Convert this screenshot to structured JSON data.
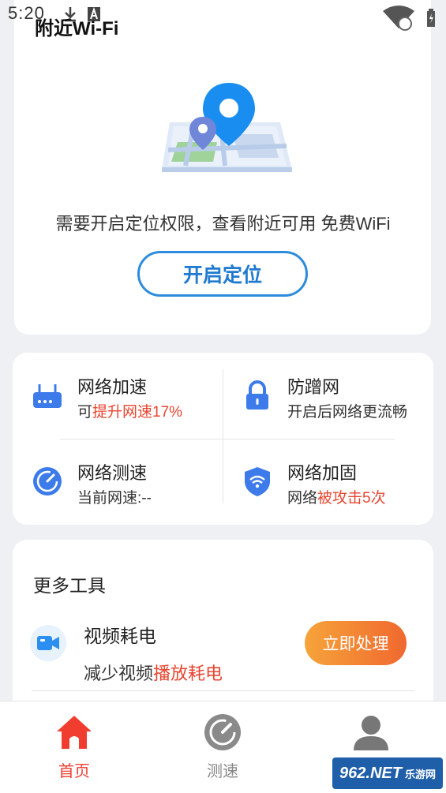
{
  "status_bar": {
    "time": "5:20",
    "icons": [
      "download-icon",
      "a-icon",
      "wifi-icon",
      "battery-icon"
    ]
  },
  "page": {
    "title": "附近Wi-Fi"
  },
  "location_card": {
    "prompt": "需要开启定位权限，查看附近可用 免费WiFi",
    "button": "开启定位"
  },
  "tools": [
    {
      "title": "网络加速",
      "desc_plain": "可",
      "desc_highlight": "提升网速17%",
      "icon": "router-icon"
    },
    {
      "title": "防蹭网",
      "desc_plain": "开启后网络更流畅",
      "desc_highlight": "",
      "icon": "lock-icon"
    },
    {
      "title": "网络测速",
      "desc_plain": "当前网速:--",
      "desc_highlight": "",
      "icon": "speedometer-icon"
    },
    {
      "title": "网络加固",
      "desc_plain": "网络",
      "desc_highlight": "被攻击5次",
      "icon": "shield-wifi-icon"
    }
  ],
  "more_tools": {
    "title": "更多工具",
    "items": [
      {
        "title": "视频耗电",
        "desc_plain": "减少视频",
        "desc_highlight": "播放耗电",
        "button": "立即处理",
        "icon": "video-camera-icon"
      }
    ]
  },
  "bottom_nav": [
    {
      "label": "首页",
      "icon": "home-icon",
      "active": true
    },
    {
      "label": "测速",
      "icon": "speedometer-icon",
      "active": false
    },
    {
      "label": "",
      "icon": "user-icon",
      "active": false
    }
  ],
  "watermark": {
    "text": "962.NET",
    "sub": "乐游网"
  },
  "colors": {
    "accent_blue": "#2f8bdc",
    "highlight_red": "#e8452f",
    "orange_start": "#f6a43a",
    "orange_end": "#f0682f"
  }
}
